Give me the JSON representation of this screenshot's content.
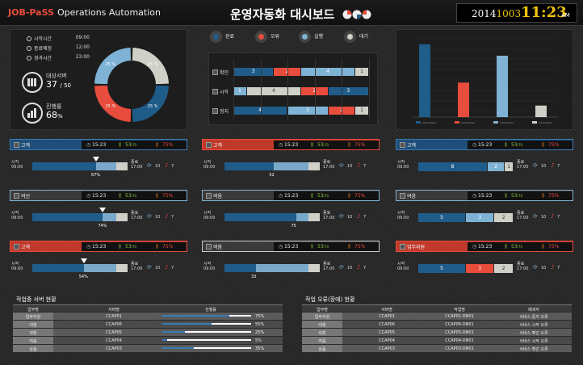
{
  "header": {
    "logo": "JOB-PaSS",
    "subtitle": "Operations Automation",
    "title": "운영자동화 대시보드",
    "date_y": "2014",
    "date_md": "1003",
    "time": "11:23",
    "ampm": "AM"
  },
  "summary": {
    "rows": [
      {
        "label": "시작시간",
        "value": "09:00"
      },
      {
        "label": "종료예정",
        "value": "12:00"
      },
      {
        "label": "경과시간",
        "value": "23:00"
      }
    ],
    "servers_label": "대상서버",
    "servers_value": "37",
    "servers_total": "/ 50",
    "progress_label": "진행률",
    "progress_value": "68",
    "progress_unit": "%",
    "donut": [
      {
        "label": "25 %",
        "color": "#1f5c8a"
      },
      {
        "label": "25 %",
        "color": "#e74c3c"
      },
      {
        "label": "25 %",
        "color": "#7fb3d5"
      },
      {
        "label": "25 %",
        "color": "#d0d0c8"
      }
    ]
  },
  "legend": [
    {
      "label": "완료",
      "color": "#1f5c8a"
    },
    {
      "label": "오류",
      "color": "#e74c3c"
    },
    {
      "label": "실행",
      "color": "#7fb3d5"
    },
    {
      "label": "대기",
      "color": "#d0d0c8"
    }
  ],
  "stack": {
    "rows": [
      {
        "label": "확인",
        "segs": [
          {
            "v": 3,
            "c": "#1f5c8a",
            "t": "3"
          },
          {
            "v": 2,
            "c": "#e74c3c",
            "t": "2"
          },
          {
            "v": 4,
            "c": "#7fb3d5",
            "t": "4"
          },
          {
            "v": 1,
            "c": "#d0d0c8",
            "t": "1"
          }
        ]
      },
      {
        "label": "시작",
        "segs": [
          {
            "v": 1,
            "c": "#7fb3d5",
            "t": "1"
          },
          {
            "v": 4,
            "c": "#d0d0c8",
            "t": "4"
          },
          {
            "v": 2,
            "c": "#e74c3c",
            "t": "2"
          },
          {
            "v": 3,
            "c": "#1f5c8a",
            "t": "3"
          }
        ]
      },
      {
        "label": "정지",
        "segs": [
          {
            "v": 4,
            "c": "#1f5c8a",
            "t": "4"
          },
          {
            "v": 3,
            "c": "#7fb3d5",
            "t": "3"
          },
          {
            "v": 2,
            "c": "#e74c3c",
            "t": "2"
          },
          {
            "v": 1,
            "c": "#d0d0c8",
            "t": "1"
          }
        ]
      }
    ]
  },
  "chart_data": {
    "type": "bar",
    "categories": [
      "Information",
      "Information",
      "Information",
      "Information"
    ],
    "values": [
      95,
      45,
      80,
      15
    ],
    "colors": [
      "#1f5c8a",
      "#e74c3c",
      "#7fb3d5",
      "#d0d0c8"
    ],
    "ylim": [
      0,
      100
    ],
    "grid": true
  },
  "cards": [
    {
      "name": "고객",
      "theme": "blue",
      "time": "15:23",
      "count": "53",
      "total": "/70",
      "pct": "75%",
      "start": "09:00",
      "end": "17:00",
      "fill": 0.67,
      "fill_text": "67%",
      "segs": [],
      "a": "10",
      "b": "7"
    },
    {
      "name": "고객",
      "theme": "red",
      "time": "15:23",
      "count": "53",
      "total": "/70",
      "pct": "75%",
      "start": "09:00",
      "end": "17:00",
      "fill": 0.52,
      "fill_text": "52",
      "segs": [],
      "a": "10",
      "b": "7"
    },
    {
      "name": "고객",
      "theme": "blue",
      "time": "15:23",
      "count": "53",
      "total": "/70",
      "pct": "75%",
      "start": "09:00",
      "end": "17:00",
      "fill": 0,
      "fill_text": "",
      "segs": [
        {
          "v": 8,
          "c": "#1f5c8a",
          "t": "8"
        },
        {
          "v": 2,
          "c": "#7fb3d5",
          "t": "2"
        },
        {
          "v": 1,
          "c": "#d0d0c8",
          "t": "1"
        }
      ],
      "a": "10",
      "b": "7"
    },
    {
      "name": "여신",
      "theme": "lblue",
      "time": "15:23",
      "count": "53",
      "total": "/70",
      "pct": "75%",
      "start": "09:00",
      "end": "17:00",
      "fill": 0.74,
      "fill_text": "74%",
      "segs": [],
      "a": "10",
      "b": "7"
    },
    {
      "name": "여음",
      "theme": "lblue",
      "time": "15:23",
      "count": "53",
      "total": "/70",
      "pct": "75%",
      "start": "09:00",
      "end": "17:00",
      "fill": 0.75,
      "fill_text": "75",
      "segs": [],
      "a": "10",
      "b": "7"
    },
    {
      "name": "여음",
      "theme": "lblue",
      "time": "15:23",
      "count": "53",
      "total": "/70",
      "pct": "75%",
      "start": "09:00",
      "end": "17:00",
      "fill": 0,
      "fill_text": "",
      "segs": [
        {
          "v": 5,
          "c": "#1f5c8a",
          "t": "5"
        },
        {
          "v": 3,
          "c": "#7fb3d5",
          "t": "3"
        },
        {
          "v": 2,
          "c": "#d0d0c8",
          "t": "2"
        }
      ],
      "a": "10",
      "b": "7"
    },
    {
      "name": "고객",
      "theme": "red",
      "time": "15:23",
      "count": "53",
      "total": "/70",
      "pct": "75%",
      "start": "09:00",
      "end": "17:00",
      "fill": 0.54,
      "fill_text": "54%",
      "segs": [],
      "a": "10",
      "b": "7"
    },
    {
      "name": "여음",
      "theme": "white",
      "time": "15:23",
      "count": "53",
      "total": "/70",
      "pct": "75%",
      "start": "09:00",
      "end": "17:00",
      "fill": 0.33,
      "fill_text": "33",
      "segs": [],
      "a": "10",
      "b": "7"
    },
    {
      "name": "업무지원",
      "theme": "red",
      "time": "15:23",
      "count": "53",
      "total": "/70",
      "pct": "75%",
      "start": "09:00",
      "end": "17:00",
      "fill": 0,
      "fill_text": "",
      "segs": [
        {
          "v": 5,
          "c": "#1f5c8a",
          "t": "5"
        },
        {
          "v": 3,
          "c": "#e74c3c",
          "t": "3"
        },
        {
          "v": 2,
          "c": "#d0d0c8",
          "t": "2"
        }
      ],
      "a": "10",
      "b": "7"
    }
  ],
  "labels": {
    "start": "시작",
    "end": "종료"
  },
  "tables": {
    "left": {
      "title": "작업중 서버 현황",
      "headers": [
        "업무명",
        "서버명",
        "진행률"
      ],
      "rows": [
        {
          "a": "업무지원",
          "b": "CCAP01",
          "p": 0.75,
          "t": "75%"
        },
        {
          "a": "대행",
          "b": "CCAP06",
          "p": 0.55,
          "t": "55%"
        },
        {
          "a": "외환",
          "b": "CCAP05",
          "p": 0.25,
          "t": "25%"
        },
        {
          "a": "여음",
          "b": "CCAP04",
          "p": 0.05,
          "t": "5%"
        },
        {
          "a": "상품",
          "b": "CCAP03",
          "p": 0.35,
          "t": "35%"
        }
      ]
    },
    "right": {
      "title": "작업 오류(장애) 현황",
      "headers": [
        "업무명",
        "서버명",
        "작업명",
        "메세지"
      ],
      "rows": [
        {
          "a": "업무지원",
          "b": "CCAP01",
          "c": "CCAP01-DN01",
          "d": "서비스 중지 오류"
        },
        {
          "a": "대행",
          "b": "CCAP06",
          "c": "CCAP06-DN01",
          "d": "서비스 시작 오류"
        },
        {
          "a": "외환",
          "b": "CCAP05",
          "c": "CCAP05-DN01",
          "d": "서비스 확인 오류"
        },
        {
          "a": "여음",
          "b": "CCAP04",
          "c": "CCAP04-DN01",
          "d": "서비스 시작 오류"
        },
        {
          "a": "상품",
          "b": "CCAP03",
          "c": "CCAP03-DN01",
          "d": "서비스 확인 오류"
        }
      ]
    }
  }
}
